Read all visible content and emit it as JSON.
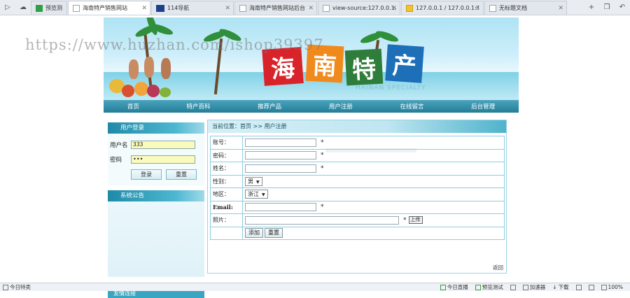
{
  "browser": {
    "tabs": [
      {
        "title": "预览测试",
        "icon": "green-square-icon",
        "active": false
      },
      {
        "title": "海南特产销售网站",
        "icon": "page-icon",
        "active": true
      },
      {
        "title": "114导航",
        "icon": "site-114-icon",
        "active": false
      },
      {
        "title": "海南特产销售网站后台",
        "icon": "page-icon",
        "active": false
      },
      {
        "title": "view-source:127.0.0.1/",
        "icon": "page-icon",
        "active": false
      },
      {
        "title": "127.0.0.1 / 127.0.0.1:3",
        "icon": "pma-icon",
        "active": false
      },
      {
        "title": "无标题文档",
        "icon": "page-icon",
        "active": false
      }
    ]
  },
  "watermark": "https://www.huzhan.com/ishop39397",
  "banner": {
    "logo_chars": [
      "海",
      "南",
      "特",
      "产"
    ],
    "logo_sub": "HAINAN SPECIALTY"
  },
  "nav": {
    "items": [
      "首页",
      "特产百科",
      "推荐产品",
      "用户注册",
      "在线留言",
      "后台管理"
    ]
  },
  "login": {
    "title": "用户登录",
    "username_label": "用户名",
    "username_value": "333",
    "password_label": "密码",
    "password_value": "•••",
    "login_button": "登录",
    "reset_button": "重置"
  },
  "notice": {
    "title": "系统公告"
  },
  "links": {
    "title": "友情连接"
  },
  "breadcrumb": {
    "prefix": "当前位置：",
    "home": "首页",
    "sep": ">>",
    "current": "用户注册"
  },
  "register_form": {
    "account_label": "账号：",
    "password_label": "密码：",
    "name_label": "姓名：",
    "gender_label": "性别：",
    "gender_value": "男",
    "region_label": "地区：",
    "region_value": "浙江",
    "email_label": "Email:",
    "photo_label": "照片：",
    "upload_button": "上传",
    "required_mark": "*",
    "submit_button": "添加",
    "reset_button": "重置",
    "back_link": "返回"
  },
  "statusbar": {
    "left": "今日特卖",
    "items": [
      "今日直播",
      "预览测试",
      "加速器",
      "下载",
      "100%"
    ]
  },
  "colors": {
    "nav_bg": "#257e98",
    "side_head_bg": "#1f8aa8",
    "input_yellow": "#fafabc",
    "border_teal": "#8ccde0"
  }
}
